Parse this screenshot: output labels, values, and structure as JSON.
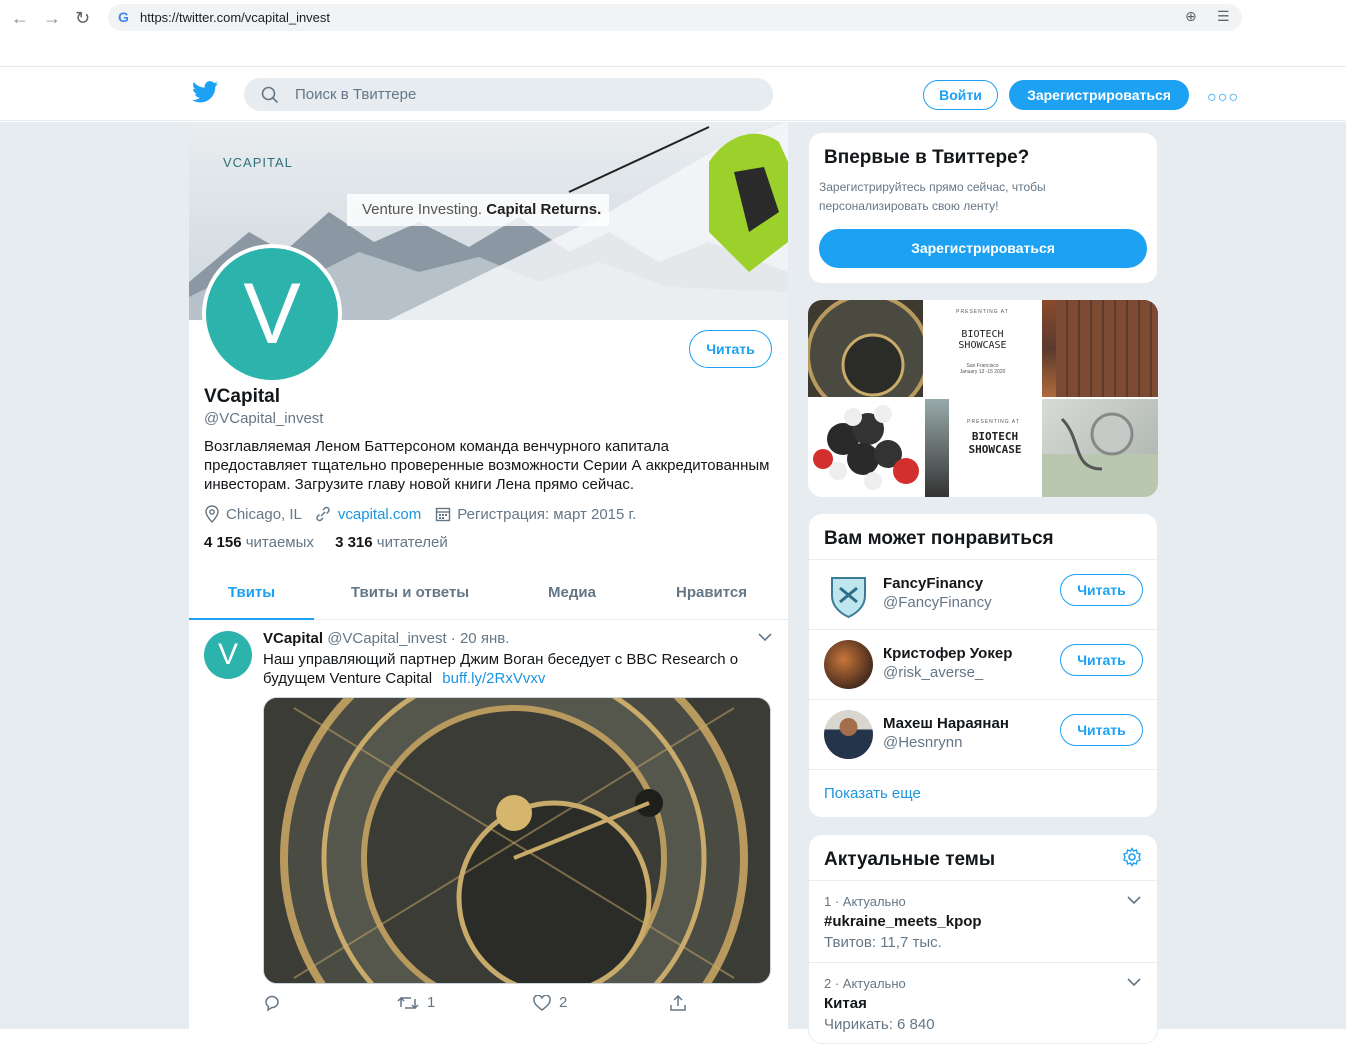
{
  "browser": {
    "url": "https://twitter.com/vcapital_invest"
  },
  "header": {
    "search_placeholder": "Поиск в Твиттере",
    "login": "Войти",
    "signup": "Зарегистрироваться"
  },
  "banner": {
    "brand": "VCAPITAL",
    "tagline_light": "Venture Investing.",
    "tagline_bold": "Capital Returns."
  },
  "profile": {
    "avatar_letter": "V",
    "follow": "Читать",
    "name": "VCapital",
    "handle": "@VCapital_invest",
    "bio": "Возглавляемая Леном Баттерсоном команда венчурного капитала предоставляет тщательно проверенные возможности Серии А аккредитованным инвесторам. Загрузите главу новой книги Лена прямо сейчас.",
    "location": "Chicago, IL",
    "website": "vcapital.com",
    "joined": "Регистрация: март 2015 г.",
    "following_count": "4 156",
    "following_label": "читаемых",
    "followers_count": "3 316",
    "followers_label": "читателей"
  },
  "tabs": [
    "Твиты",
    "Твиты и ответы",
    "Медиа",
    "Нравится"
  ],
  "tweet": {
    "avatar_letter": "V",
    "name": "VCapital",
    "meta": "@VCapital_invest · 20 янв.",
    "text": "Наш управляющий партнер Джим Воган беседует с BBC Research о будущем Venture Capital",
    "link": "buff.ly/2RxVvxv",
    "retweets": "1",
    "likes": "2"
  },
  "signup_card": {
    "title": "Впервые в Твиттере?",
    "text": "Зарегистрируйтесь прямо сейчас, чтобы персонализировать свою ленту!",
    "button": "Зарегистрироваться"
  },
  "mosaic": {
    "showcase_small_top": "PRESENTING AT",
    "showcase_small_title": "BIOTECH SHOWCASE",
    "showcase_small_place": "San Francisco January 13 -15 2020",
    "showcase_top": "PRESENTING AT",
    "showcase_title": "BIOTECH SHOWCASE"
  },
  "who_to_follow": {
    "title": "Вам может понравиться",
    "users": [
      {
        "name": "FancyFinancy",
        "handle": "@FancyFinancy",
        "button": "Читать"
      },
      {
        "name": "Кристофер Уокер",
        "handle": "@risk_averse_",
        "button": "Читать"
      },
      {
        "name": "Махеш Нараянан",
        "handle": "@Hesnrynn",
        "button": "Читать"
      }
    ],
    "show_more": "Показать еще"
  },
  "trends": {
    "title": "Актуальные темы",
    "items": [
      {
        "meta": "1 · Актуально",
        "tag": "#ukraine_meets_kpop",
        "count": "Твитов: 11,7 тыс."
      },
      {
        "meta": "2 · Актуально",
        "tag": "Китая",
        "count": "Чирикать: 6 840"
      }
    ]
  },
  "colors": {
    "accent": "#1da1f2",
    "avatar_teal": "#2bb3ac"
  }
}
